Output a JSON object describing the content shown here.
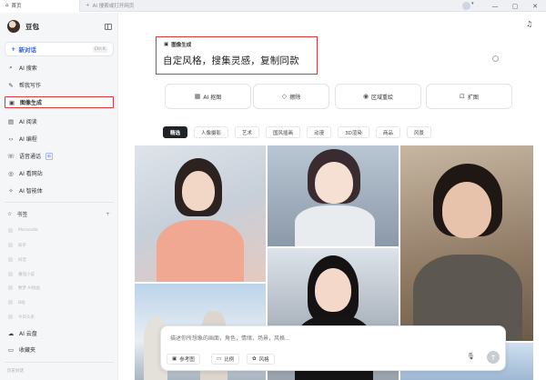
{
  "window": {
    "tabs": [
      {
        "label": "首页",
        "icon": "home-icon"
      },
      {
        "label": "AI 搜索或打开网页",
        "icon": "plus-icon"
      }
    ],
    "controls": [
      "minimize-icon",
      "restore-icon",
      "close-icon"
    ]
  },
  "sidebar": {
    "brand_name": "豆包",
    "new_chat": {
      "label": "新对话",
      "shortcut": "Ctrl K"
    },
    "items": [
      {
        "label": "AI 搜索",
        "icon": "search-icon"
      },
      {
        "label": "帮我写作",
        "icon": "pen-icon"
      },
      {
        "label": "图像生成",
        "icon": "image-icon"
      },
      {
        "label": "AI 阅读",
        "icon": "book-icon"
      },
      {
        "label": "AI 编程",
        "icon": "code-icon"
      },
      {
        "label": "语音通话",
        "icon": "phone-icon",
        "badge": "新"
      },
      {
        "label": "AI 看网站",
        "icon": "globe-icon"
      },
      {
        "label": "AI 智能体",
        "icon": "agent-icon"
      }
    ],
    "bookmarks_title": "书签",
    "bookmarks": [
      "Marscode",
      "知乎",
      "抖音",
      "番茄小说",
      "数梦 AI绘画",
      "B站",
      "今日头条"
    ],
    "cloud_drive": "AI 云盘",
    "favorites": "收藏夹",
    "history": "历史对话"
  },
  "main": {
    "section_label": "图像生成",
    "headline": "自定风格，搜集灵感，复制同款",
    "tools": [
      {
        "label": "AI 抠图",
        "icon": "cutout-icon"
      },
      {
        "label": "擦除",
        "icon": "eraser-icon"
      },
      {
        "label": "区域重绘",
        "icon": "redraw-icon"
      },
      {
        "label": "扩图",
        "icon": "expand-icon"
      }
    ],
    "categories": [
      "精选",
      "人像摄影",
      "艺术",
      "国风插画",
      "动漫",
      "3D渲染",
      "商品",
      "风景"
    ],
    "active_category": "精选",
    "prompt": {
      "placeholder": "描述你所想象的画面，角色，情绪，场景，风格...",
      "ref_label": "参考图",
      "ratio_label": "比例",
      "style_label": "风格"
    }
  },
  "colors": {
    "accent": "#2f62d6",
    "highlight_border": "#d9373a",
    "active_category_bg": "#1f2226"
  }
}
